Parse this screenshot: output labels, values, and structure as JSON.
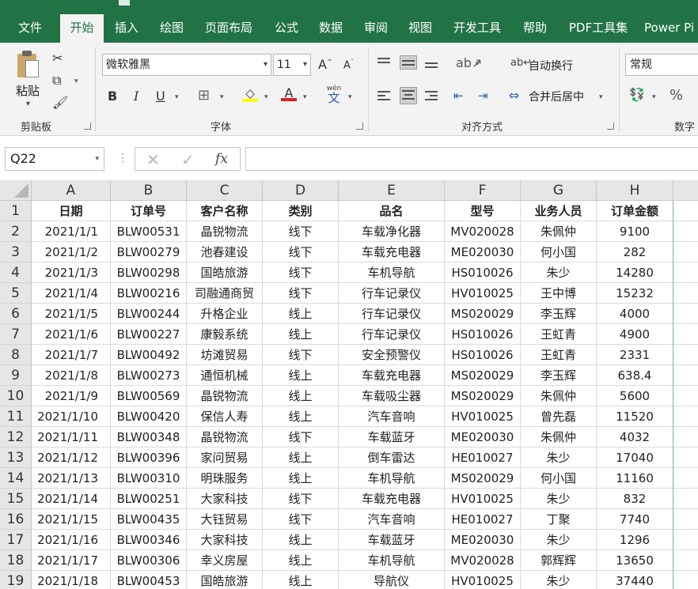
{
  "tabs": [
    "文件",
    "开始",
    "插入",
    "绘图",
    "页面布局",
    "公式",
    "数据",
    "审阅",
    "视图",
    "开发工具",
    "帮助",
    "PDF工具集",
    "Power Pi"
  ],
  "ribbon": {
    "clipboard": {
      "paste_label": "粘贴",
      "group_label": "剪贴板"
    },
    "font": {
      "family": "微软雅黑",
      "size": "11",
      "bold": "B",
      "italic": "I",
      "underline": "U",
      "wen": "wén",
      "wen_char": "文",
      "grow": "A",
      "shrink": "A",
      "color_letter": "A",
      "group_label": "字体"
    },
    "alignment": {
      "wrap_text": "自动换行",
      "merge_center": "合并后居中",
      "group_label": "对齐方式"
    },
    "number": {
      "format": "常规",
      "percent": "%",
      "group_label": "数字"
    }
  },
  "formula_bar": {
    "name_box": "Q22",
    "fx": "fx",
    "value": ""
  },
  "columns": [
    "A",
    "B",
    "C",
    "D",
    "E",
    "F",
    "G",
    "H"
  ],
  "header_row": [
    "日期",
    "订单号",
    "客户名称",
    "类别",
    "品名",
    "型号",
    "业务人员",
    "订单金额"
  ],
  "rows": [
    [
      "2021/1/1",
      "BLW00531",
      "晶锐物流",
      "线下",
      "车载净化器",
      "MV020028",
      "朱佩仲",
      "9100"
    ],
    [
      "2021/1/2",
      "BLW00279",
      "池春建设",
      "线下",
      "车载充电器",
      "ME020030",
      "何小国",
      "282"
    ],
    [
      "2021/1/3",
      "BLW00298",
      "国皓旅游",
      "线下",
      "车机导航",
      "HS010026",
      "朱少",
      "14280"
    ],
    [
      "2021/1/4",
      "BLW00216",
      "司融通商贸",
      "线下",
      "行车记录仪",
      "HV010025",
      "王中博",
      "15232"
    ],
    [
      "2021/1/5",
      "BLW00244",
      "升格企业",
      "线上",
      "行车记录仪",
      "MS020029",
      "李玉辉",
      "4000"
    ],
    [
      "2021/1/6",
      "BLW00227",
      "康毅系统",
      "线上",
      "行车记录仪",
      "HS010026",
      "王虹青",
      "4900"
    ],
    [
      "2021/1/7",
      "BLW00492",
      "坊滩贸易",
      "线下",
      "安全预警仪",
      "HS010026",
      "王虹青",
      "2331"
    ],
    [
      "2021/1/8",
      "BLW00273",
      "通恒机械",
      "线上",
      "车载充电器",
      "MS020029",
      "李玉辉",
      "638.4"
    ],
    [
      "2021/1/9",
      "BLW00569",
      "晶锐物流",
      "线上",
      "车载吸尘器",
      "MS020029",
      "朱佩仲",
      "5600"
    ],
    [
      "2021/1/10",
      "BLW00420",
      "保信人寿",
      "线上",
      "汽车音响",
      "HV010025",
      "曾先磊",
      "11520"
    ],
    [
      "2021/1/11",
      "BLW00348",
      "晶锐物流",
      "线下",
      "车载蓝牙",
      "ME020030",
      "朱佩仲",
      "4032"
    ],
    [
      "2021/1/12",
      "BLW00396",
      "家问贸易",
      "线上",
      "倒车雷达",
      "HE010027",
      "朱少",
      "17040"
    ],
    [
      "2021/1/13",
      "BLW00310",
      "明珠服务",
      "线上",
      "车机导航",
      "MS020029",
      "何小国",
      "11160"
    ],
    [
      "2021/1/14",
      "BLW00251",
      "大家科技",
      "线下",
      "车载充电器",
      "HV010025",
      "朱少",
      "832"
    ],
    [
      "2021/1/15",
      "BLW00435",
      "大钰贸易",
      "线下",
      "汽车音响",
      "HE010027",
      "丁聚",
      "7740"
    ],
    [
      "2021/1/16",
      "BLW00346",
      "大家科技",
      "线上",
      "车载蓝牙",
      "ME020030",
      "朱少",
      "1296"
    ],
    [
      "2021/1/17",
      "BLW00306",
      "幸义房屋",
      "线上",
      "车机导航",
      "MV020028",
      "郭辉辉",
      "13650"
    ],
    [
      "2021/1/18",
      "BLW00453",
      "国皓旅游",
      "线上",
      "导航仪",
      "HV010025",
      "朱少",
      "37440"
    ]
  ],
  "row_numbers": [
    "1",
    "2",
    "3",
    "4",
    "5",
    "6",
    "7",
    "8",
    "9",
    "10",
    "11",
    "12",
    "13",
    "14",
    "15",
    "16",
    "17",
    "18",
    "19"
  ],
  "colors": {
    "excel_green": "#217346",
    "ribbon_bg": "#f3f3f3",
    "header_bg": "#e6e6e6"
  }
}
